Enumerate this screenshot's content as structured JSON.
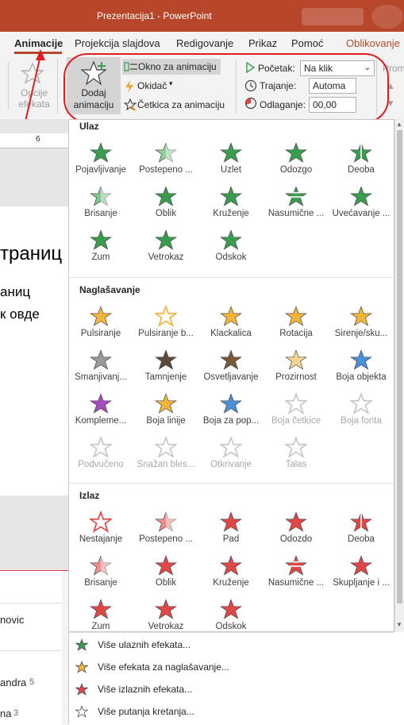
{
  "window": {
    "title": "Prezentacija1 - PowerPoint"
  },
  "tabs": [
    "Animacije",
    "Projekcija slajdova",
    "Redigovanje",
    "Prikaz",
    "Pomoć",
    "Oblikovanje"
  ],
  "ribbon": {
    "effect_options_label": "Opcije efekata",
    "add_animation_label": "Dodaj animaciju",
    "animation_pane": "Okno za animaciju",
    "trigger": "Okidač",
    "animation_painter": "Četkica za animaciju",
    "start_label": "Početak:",
    "start_value": "Na klik",
    "duration_label": "Trajanje:",
    "duration_value": "Automa",
    "delay_label": "Odlaganje:",
    "delay_value": "00,00",
    "cut_label": "Prom"
  },
  "slide": {
    "ruler_mark": "6",
    "line1": "траниц",
    "line2": "аниц",
    "line3": "к овде"
  },
  "gallery": {
    "sections": [
      {
        "title": "Ulaz",
        "items": [
          {
            "label": "Pojavljivanje",
            "color": "#3a9c4e",
            "icon": "star-icon"
          },
          {
            "label": "Postepeno ...",
            "color": "#8fcf9b",
            "icon": "star-fade-icon"
          },
          {
            "label": "Uzlet",
            "color": "#3a9c4e",
            "icon": "star-icon"
          },
          {
            "label": "Odozgo",
            "color": "#3a9c4e",
            "icon": "star-icon"
          },
          {
            "label": "Deoba",
            "color": "#3a9c4e",
            "icon": "star-split-icon"
          },
          {
            "label": "Brisanje",
            "color": "#7fc48c",
            "icon": "star-wipe-icon"
          },
          {
            "label": "Oblik",
            "color": "#3a9c4e",
            "icon": "star-icon"
          },
          {
            "label": "Kruženje",
            "color": "#3a9c4e",
            "icon": "star-icon"
          },
          {
            "label": "Nasumične ...",
            "color": "#3a9c4e",
            "icon": "star-bars-icon"
          },
          {
            "label": "Uvećavanje ...",
            "color": "#3a9c4e",
            "icon": "star-grow-icon"
          },
          {
            "label": "Zum",
            "color": "#3a9c4e",
            "icon": "star-zoom-icon"
          },
          {
            "label": "Vetrokaz",
            "color": "#3a9c4e",
            "icon": "star-swivel-icon"
          },
          {
            "label": "Odskok",
            "color": "#3a9c4e",
            "icon": "star-bounce-icon"
          }
        ]
      },
      {
        "title": "Naglašavanje",
        "items": [
          {
            "label": "Pulsiranje",
            "color": "#f0b53a",
            "icon": "star-icon"
          },
          {
            "label": "Pulsiranje b...",
            "color": "#f0b53a",
            "icon": "star-outline-icon"
          },
          {
            "label": "Klackalica",
            "color": "#f0b53a",
            "icon": "star-tilt-icon"
          },
          {
            "label": "Rotacija",
            "color": "#f0b53a",
            "icon": "star-rotate-icon"
          },
          {
            "label": "Širenje/sku...",
            "color": "#f0b53a",
            "icon": "star-grow-icon"
          },
          {
            "label": "Smanjivanj...",
            "color": "#9a9a9a",
            "icon": "star-desaturate-icon"
          },
          {
            "label": "Tamnjenje",
            "color": "#5a4a3a",
            "icon": "star-darken-icon"
          },
          {
            "label": "Osvetljavanje",
            "color": "#7a5a3a",
            "icon": "star-lighten-icon"
          },
          {
            "label": "Prozirnost",
            "color": "#f5d590",
            "icon": "star-transparency-icon"
          },
          {
            "label": "Boja objekta",
            "color": "#4a90d9",
            "icon": "star-objectcolor-icon"
          },
          {
            "label": "Kompleme...",
            "color": "#a74cc0",
            "icon": "star-complement-icon"
          },
          {
            "label": "Boja linije",
            "color": "#f0b53a",
            "icon": "star-linecolor-icon"
          },
          {
            "label": "Boja za pop...",
            "color": "#4a90d9",
            "icon": "star-fillcolor-icon"
          },
          {
            "label": "Boja četkice",
            "color": "#c8c8c8",
            "icon": "star-brush-icon",
            "disabled": true
          },
          {
            "label": "Boja fonta",
            "color": "#c8c8c8",
            "icon": "star-fontcolor-icon",
            "disabled": true
          },
          {
            "label": "Podvučeno",
            "color": "#c8c8c8",
            "icon": "star-underline-icon",
            "disabled": true
          },
          {
            "label": "Snažan bles...",
            "color": "#c8c8c8",
            "icon": "star-boldflash-icon",
            "disabled": true
          },
          {
            "label": "Otkrivanje",
            "color": "#c8c8c8",
            "icon": "star-reveal-icon",
            "disabled": true
          },
          {
            "label": "Talas",
            "color": "#c8c8c8",
            "icon": "star-wave-icon",
            "disabled": true
          }
        ]
      },
      {
        "title": "Izlaz",
        "items": [
          {
            "label": "Nestajanje",
            "color": "#e04848",
            "icon": "star-outline-icon"
          },
          {
            "label": "Postepeno ...",
            "color": "#f08c8c",
            "icon": "star-fade-icon"
          },
          {
            "label": "Pad",
            "color": "#e04848",
            "icon": "star-icon"
          },
          {
            "label": "Odozdo",
            "color": "#e04848",
            "icon": "star-icon"
          },
          {
            "label": "Deoba",
            "color": "#e04848",
            "icon": "star-split-icon"
          },
          {
            "label": "Brisanje",
            "color": "#f08c8c",
            "icon": "star-wipe-icon"
          },
          {
            "label": "Oblik",
            "color": "#e04848",
            "icon": "star-icon"
          },
          {
            "label": "Kruženje",
            "color": "#e04848",
            "icon": "star-icon"
          },
          {
            "label": "Nasumične ...",
            "color": "#e04848",
            "icon": "star-bars-icon"
          },
          {
            "label": "Skupljanje i ...",
            "color": "#e04848",
            "icon": "star-shrink-icon"
          },
          {
            "label": "Zum",
            "color": "#e04848",
            "icon": "star-zoom-icon"
          },
          {
            "label": "Vetrokaz",
            "color": "#e04848",
            "icon": "star-swivel-icon"
          },
          {
            "label": "Odskok",
            "color": "#e04848",
            "icon": "star-bounce-icon"
          }
        ]
      }
    ]
  },
  "more_effects": [
    {
      "label": "Više ulaznih efekata...",
      "color": "#3a9c4e"
    },
    {
      "label": "Više efekata za naglašavanje...",
      "color": "#f0b53a"
    },
    {
      "label": "Više izlaznih efekata...",
      "color": "#e04848"
    },
    {
      "label": "Više putanja kretanja...",
      "color": "#ffffff"
    }
  ],
  "notes_panel": {
    "names": [
      {
        "name": "novic",
        "count": ""
      },
      {
        "name": "andra",
        "count": "5"
      },
      {
        "name": "na",
        "count": "3"
      }
    ]
  }
}
